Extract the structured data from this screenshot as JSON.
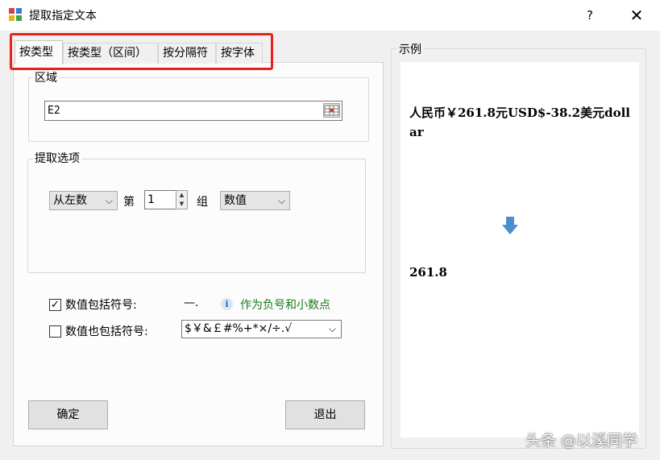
{
  "window": {
    "title": "提取指定文本",
    "help": "?",
    "close": "✕"
  },
  "tabs": [
    {
      "label": "按类型",
      "active": true
    },
    {
      "label": "按类型（区间）",
      "active": false
    },
    {
      "label": "按分隔符",
      "active": false
    },
    {
      "label": "按字体",
      "active": false
    }
  ],
  "area": {
    "label": "区域",
    "value": "E2"
  },
  "extract_options": {
    "label": "提取选项",
    "direction": "从左数",
    "ordinal_prefix": "第",
    "group_number": "1",
    "group_suffix": "组",
    "type": "数值"
  },
  "include_symbols": {
    "label": "数值包括符号:",
    "checked": true,
    "symbols": "—.",
    "info_icon": "info-icon",
    "info_text": "作为负号和小数点"
  },
  "also_include_symbols": {
    "label": "数值也包括符号:",
    "checked": false,
    "value": "$￥&￡#%+*×/÷.√"
  },
  "buttons": {
    "ok": "确定",
    "exit": "退出"
  },
  "example": {
    "label": "示例",
    "source": "人民币￥261.8元USD$-38.2美元dollar",
    "arrow_icon": "down-arrow-icon",
    "result": "261.8"
  },
  "watermark": "头条 @以溪同学",
  "colors": {
    "highlight": "#e8211a",
    "info_text": "#1a7a1a",
    "arrow": "#4a8ed1"
  }
}
